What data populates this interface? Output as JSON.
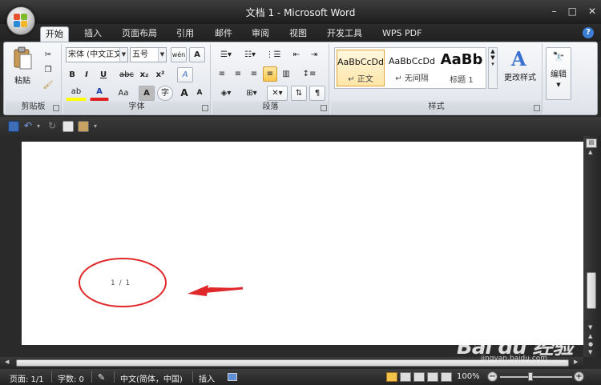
{
  "window": {
    "title": "文档 1 - Microsoft Word",
    "minimize": "–",
    "maximize": "□",
    "close": "✕"
  },
  "tabs": [
    "开始",
    "插入",
    "页面布局",
    "引用",
    "邮件",
    "审阅",
    "视图",
    "开发工具",
    "WPS PDF"
  ],
  "help": "?",
  "ribbon": {
    "clipboard": {
      "label": "剪贴板",
      "paste": "粘贴"
    },
    "font": {
      "label": "字体",
      "font_name": "宋体 (中文正文",
      "font_size": "五号",
      "wen": "wén",
      "A": "A",
      "bold": "B",
      "italic": "I",
      "underline": "U",
      "strike": "abc",
      "sub": "x₂",
      "sup": "x²",
      "clear": "A",
      "highlight": "ab",
      "color": "A",
      "case": "Aa",
      "shade": "A",
      "circle": "字",
      "grow": "A",
      "shrink": "A"
    },
    "paragraph": {
      "label": "段落"
    },
    "styles": {
      "label": "样式",
      "items": [
        {
          "sample": "AaBbCcDd",
          "name": "↵ 正文"
        },
        {
          "sample": "AaBbCcDd",
          "name": "↵ 无间隔"
        },
        {
          "sample": "AaBb",
          "name": "标题 1"
        }
      ],
      "change_styles": "更改样式"
    },
    "editing": {
      "label": "编辑"
    }
  },
  "document": {
    "page_number": "1 / 1"
  },
  "status": {
    "page": "页面: 1/1",
    "words": "字数: 0",
    "language": "中文(简体，中国)",
    "insert": "插入",
    "zoom": "100%",
    "zoom_minus": "−",
    "zoom_plus": "+"
  },
  "watermark": {
    "text": "Bai du 经验",
    "sub": "jingyan.baidu.com"
  },
  "colors": {
    "annotation_red": "#e0282a",
    "highlight_yellow": "#ffff00",
    "font_red": "#e02020"
  }
}
